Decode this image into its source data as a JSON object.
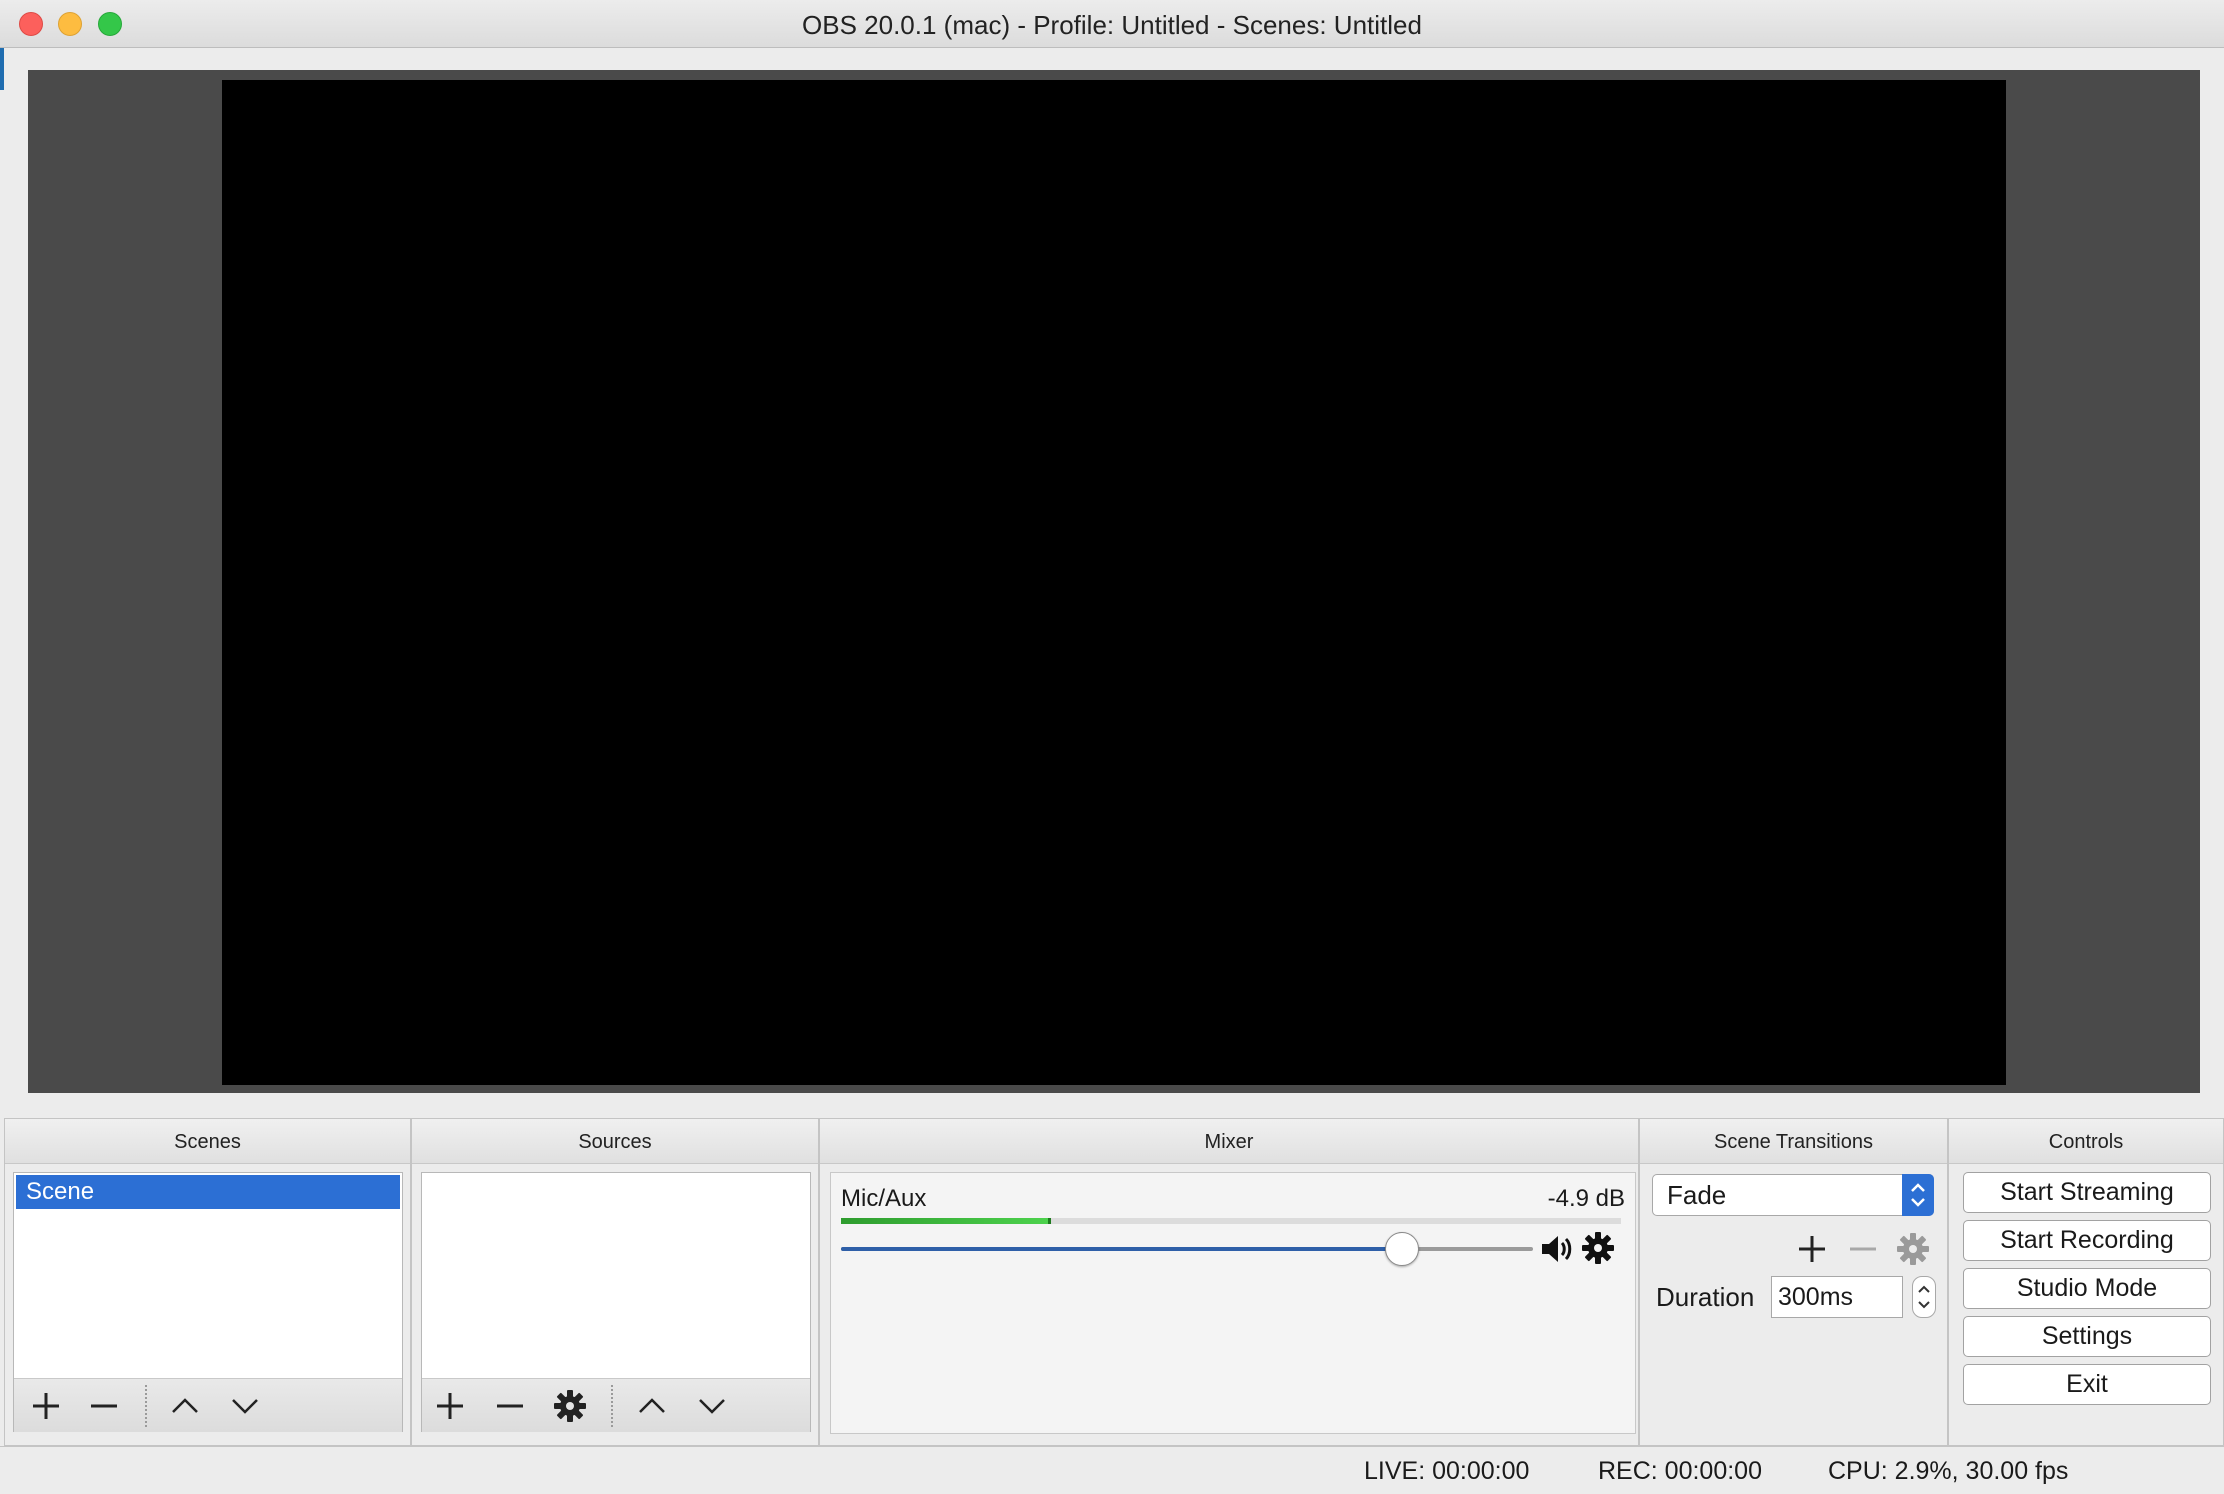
{
  "window": {
    "title": "OBS 20.0.1 (mac) - Profile: Untitled - Scenes: Untitled"
  },
  "docks": {
    "scenes": {
      "title": "Scenes",
      "items": [
        "Scene"
      ]
    },
    "sources": {
      "title": "Sources",
      "items": []
    },
    "mixer": {
      "title": "Mixer",
      "channel": {
        "name": "Mic/Aux",
        "level_db": "-4.9 dB",
        "meter_fraction": 0.265,
        "volume_fraction": 0.81
      }
    },
    "transitions": {
      "title": "Scene Transitions",
      "selected": "Fade",
      "duration_label": "Duration",
      "duration_value": "300ms"
    },
    "controls": {
      "title": "Controls",
      "buttons": [
        "Start Streaming",
        "Start Recording",
        "Studio Mode",
        "Settings",
        "Exit"
      ]
    }
  },
  "status": {
    "live": "LIVE: 00:00:00",
    "rec": "REC: 00:00:00",
    "cpu": "CPU: 2.9%, 30.00 fps"
  },
  "colors": {
    "accent": "#2c6fd4",
    "meter": "#4dd24d",
    "preview_bg": "#4a4a4a"
  }
}
